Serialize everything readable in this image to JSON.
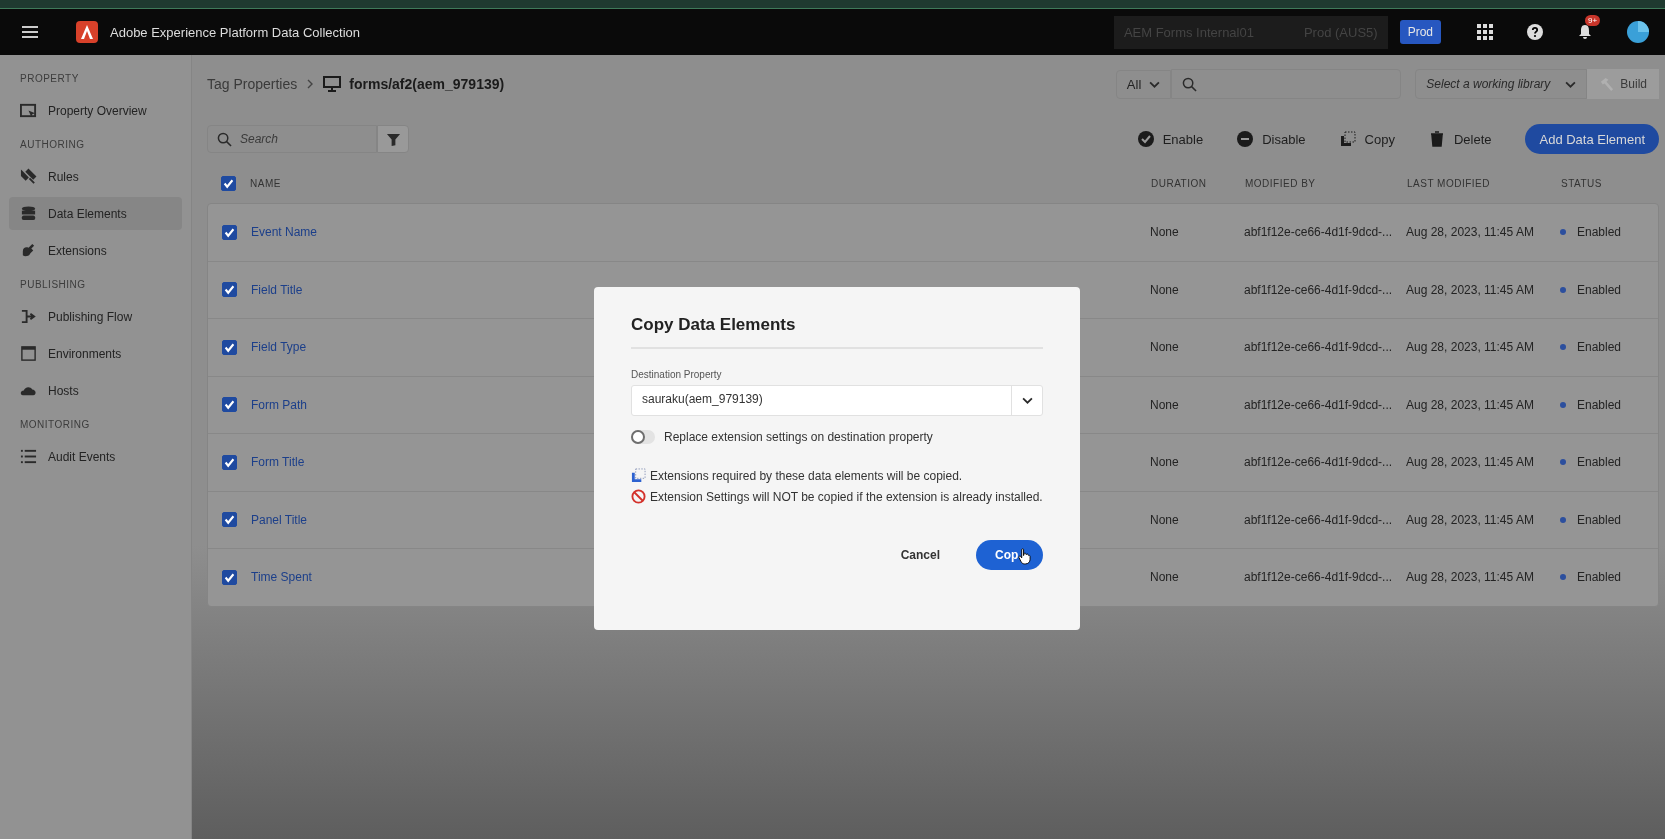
{
  "header": {
    "app_title": "Adobe Experience Platform Data Collection",
    "org": "AEM Forms Internal01",
    "region": "Prod (AUS5)",
    "env_badge": "Prod",
    "notification_count": "9+"
  },
  "sidebar": {
    "sections": [
      {
        "heading": "PROPERTY",
        "items": [
          {
            "label": "Property Overview",
            "selected": false
          }
        ]
      },
      {
        "heading": "AUTHORING",
        "items": [
          {
            "label": "Rules",
            "selected": false
          },
          {
            "label": "Data Elements",
            "selected": true
          },
          {
            "label": "Extensions",
            "selected": false
          }
        ]
      },
      {
        "heading": "PUBLISHING",
        "items": [
          {
            "label": "Publishing Flow",
            "selected": false
          },
          {
            "label": "Environments",
            "selected": false
          },
          {
            "label": "Hosts",
            "selected": false
          }
        ]
      },
      {
        "heading": "MONITORING",
        "items": [
          {
            "label": "Audit Events",
            "selected": false
          }
        ]
      }
    ]
  },
  "breadcrumb": {
    "parent": "Tag Properties",
    "current": "forms/af2(aem_979139)"
  },
  "top_search": {
    "scope": "All"
  },
  "library": {
    "placeholder": "Select a working library",
    "build": "Build"
  },
  "search": {
    "placeholder": "Search"
  },
  "actions": [
    "Enable",
    "Disable",
    "Copy",
    "Delete"
  ],
  "add_button": "Add Data Element",
  "table": {
    "all_checked": true,
    "columns": [
      "NAME",
      "DURATION",
      "MODIFIED BY",
      "LAST MODIFIED",
      "STATUS"
    ],
    "rows": [
      {
        "checked": true,
        "name": "Event Name",
        "duration": "None",
        "modified_by": "abf1f12e-ce66-4d1f-9dcd-...",
        "last_modified": "Aug 28, 2023, 11:45 AM",
        "status": "Enabled",
        "color": "#2c4f9e"
      },
      {
        "checked": true,
        "name": "Field Title",
        "duration": "None",
        "modified_by": "abf1f12e-ce66-4d1f-9dcd-...",
        "last_modified": "Aug 28, 2023, 11:45 AM",
        "status": "Enabled",
        "color": "#2c4f9e"
      },
      {
        "checked": true,
        "name": "Field Type",
        "duration": "None",
        "modified_by": "abf1f12e-ce66-4d1f-9dcd-...",
        "last_modified": "Aug 28, 2023, 11:45 AM",
        "status": "Enabled",
        "color": "#2c4f9e"
      },
      {
        "checked": true,
        "name": "Form Path",
        "duration": "None",
        "modified_by": "abf1f12e-ce66-4d1f-9dcd-...",
        "last_modified": "Aug 28, 2023, 11:45 AM",
        "status": "Enabled",
        "color": "#2c4f9e"
      },
      {
        "checked": true,
        "name": "Form Title",
        "duration": "None",
        "modified_by": "abf1f12e-ce66-4d1f-9dcd-...",
        "last_modified": "Aug 28, 2023, 11:45 AM",
        "status": "Enabled",
        "color": "#2c4f9e"
      },
      {
        "checked": true,
        "name": "Panel Title",
        "duration": "None",
        "modified_by": "abf1f12e-ce66-4d1f-9dcd-...",
        "last_modified": "Aug 28, 2023, 11:45 AM",
        "status": "Enabled",
        "color": "#2c4f9e"
      },
      {
        "checked": true,
        "name": "Time Spent",
        "duration": "None",
        "modified_by": "abf1f12e-ce66-4d1f-9dcd-...",
        "last_modified": "Aug 28, 2023, 11:45 AM",
        "status": "Enabled",
        "color": "#2c4f9e"
      }
    ]
  },
  "dialog": {
    "title": "Copy Data Elements",
    "field_label": "Destination Property",
    "field_value": "sauraku(aem_979139)",
    "toggle": {
      "label": "Replace extension settings on destination property",
      "on": false
    },
    "notes": [
      {
        "kind": "copy",
        "text": "Extensions required by these data elements will be copied."
      },
      {
        "kind": "blocked",
        "text": "Extension Settings will NOT be copied if the extension is already installed."
      }
    ],
    "buttons": [
      {
        "label": "Cancel",
        "kind": "secondary"
      },
      {
        "label": "Cop",
        "kind": "primary"
      }
    ]
  }
}
